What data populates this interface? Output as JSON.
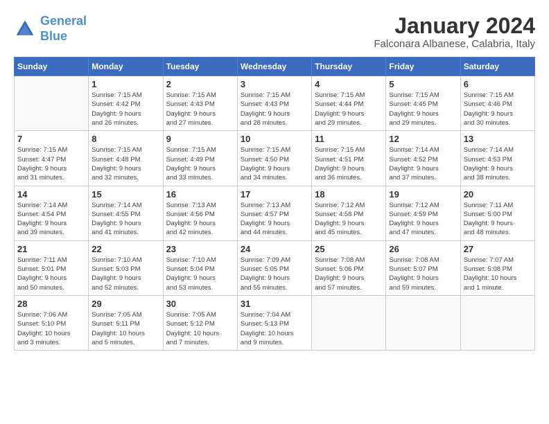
{
  "header": {
    "logo_line1": "General",
    "logo_line2": "Blue",
    "title": "January 2024",
    "subtitle": "Falconara Albanese, Calabria, Italy"
  },
  "weekdays": [
    "Sunday",
    "Monday",
    "Tuesday",
    "Wednesday",
    "Thursday",
    "Friday",
    "Saturday"
  ],
  "weeks": [
    [
      {
        "day": "",
        "info": ""
      },
      {
        "day": "1",
        "info": "Sunrise: 7:15 AM\nSunset: 4:42 PM\nDaylight: 9 hours\nand 26 minutes."
      },
      {
        "day": "2",
        "info": "Sunrise: 7:15 AM\nSunset: 4:43 PM\nDaylight: 9 hours\nand 27 minutes."
      },
      {
        "day": "3",
        "info": "Sunrise: 7:15 AM\nSunset: 4:43 PM\nDaylight: 9 hours\nand 28 minutes."
      },
      {
        "day": "4",
        "info": "Sunrise: 7:15 AM\nSunset: 4:44 PM\nDaylight: 9 hours\nand 29 minutes."
      },
      {
        "day": "5",
        "info": "Sunrise: 7:15 AM\nSunset: 4:45 PM\nDaylight: 9 hours\nand 29 minutes."
      },
      {
        "day": "6",
        "info": "Sunrise: 7:15 AM\nSunset: 4:46 PM\nDaylight: 9 hours\nand 30 minutes."
      }
    ],
    [
      {
        "day": "7",
        "info": "Sunrise: 7:15 AM\nSunset: 4:47 PM\nDaylight: 9 hours\nand 31 minutes."
      },
      {
        "day": "8",
        "info": "Sunrise: 7:15 AM\nSunset: 4:48 PM\nDaylight: 9 hours\nand 32 minutes."
      },
      {
        "day": "9",
        "info": "Sunrise: 7:15 AM\nSunset: 4:49 PM\nDaylight: 9 hours\nand 33 minutes."
      },
      {
        "day": "10",
        "info": "Sunrise: 7:15 AM\nSunset: 4:50 PM\nDaylight: 9 hours\nand 34 minutes."
      },
      {
        "day": "11",
        "info": "Sunrise: 7:15 AM\nSunset: 4:51 PM\nDaylight: 9 hours\nand 36 minutes."
      },
      {
        "day": "12",
        "info": "Sunrise: 7:14 AM\nSunset: 4:52 PM\nDaylight: 9 hours\nand 37 minutes."
      },
      {
        "day": "13",
        "info": "Sunrise: 7:14 AM\nSunset: 4:53 PM\nDaylight: 9 hours\nand 38 minutes."
      }
    ],
    [
      {
        "day": "14",
        "info": "Sunrise: 7:14 AM\nSunset: 4:54 PM\nDaylight: 9 hours\nand 39 minutes."
      },
      {
        "day": "15",
        "info": "Sunrise: 7:14 AM\nSunset: 4:55 PM\nDaylight: 9 hours\nand 41 minutes."
      },
      {
        "day": "16",
        "info": "Sunrise: 7:13 AM\nSunset: 4:56 PM\nDaylight: 9 hours\nand 42 minutes."
      },
      {
        "day": "17",
        "info": "Sunrise: 7:13 AM\nSunset: 4:57 PM\nDaylight: 9 hours\nand 44 minutes."
      },
      {
        "day": "18",
        "info": "Sunrise: 7:12 AM\nSunset: 4:58 PM\nDaylight: 9 hours\nand 45 minutes."
      },
      {
        "day": "19",
        "info": "Sunrise: 7:12 AM\nSunset: 4:59 PM\nDaylight: 9 hours\nand 47 minutes."
      },
      {
        "day": "20",
        "info": "Sunrise: 7:11 AM\nSunset: 5:00 PM\nDaylight: 9 hours\nand 48 minutes."
      }
    ],
    [
      {
        "day": "21",
        "info": "Sunrise: 7:11 AM\nSunset: 5:01 PM\nDaylight: 9 hours\nand 50 minutes."
      },
      {
        "day": "22",
        "info": "Sunrise: 7:10 AM\nSunset: 5:03 PM\nDaylight: 9 hours\nand 52 minutes."
      },
      {
        "day": "23",
        "info": "Sunrise: 7:10 AM\nSunset: 5:04 PM\nDaylight: 9 hours\nand 53 minutes."
      },
      {
        "day": "24",
        "info": "Sunrise: 7:09 AM\nSunset: 5:05 PM\nDaylight: 9 hours\nand 55 minutes."
      },
      {
        "day": "25",
        "info": "Sunrise: 7:08 AM\nSunset: 5:06 PM\nDaylight: 9 hours\nand 57 minutes."
      },
      {
        "day": "26",
        "info": "Sunrise: 7:08 AM\nSunset: 5:07 PM\nDaylight: 9 hours\nand 59 minutes."
      },
      {
        "day": "27",
        "info": "Sunrise: 7:07 AM\nSunset: 5:08 PM\nDaylight: 10 hours\nand 1 minute."
      }
    ],
    [
      {
        "day": "28",
        "info": "Sunrise: 7:06 AM\nSunset: 5:10 PM\nDaylight: 10 hours\nand 3 minutes."
      },
      {
        "day": "29",
        "info": "Sunrise: 7:05 AM\nSunset: 5:11 PM\nDaylight: 10 hours\nand 5 minutes."
      },
      {
        "day": "30",
        "info": "Sunrise: 7:05 AM\nSunset: 5:12 PM\nDaylight: 10 hours\nand 7 minutes."
      },
      {
        "day": "31",
        "info": "Sunrise: 7:04 AM\nSunset: 5:13 PM\nDaylight: 10 hours\nand 9 minutes."
      },
      {
        "day": "",
        "info": ""
      },
      {
        "day": "",
        "info": ""
      },
      {
        "day": "",
        "info": ""
      }
    ]
  ]
}
